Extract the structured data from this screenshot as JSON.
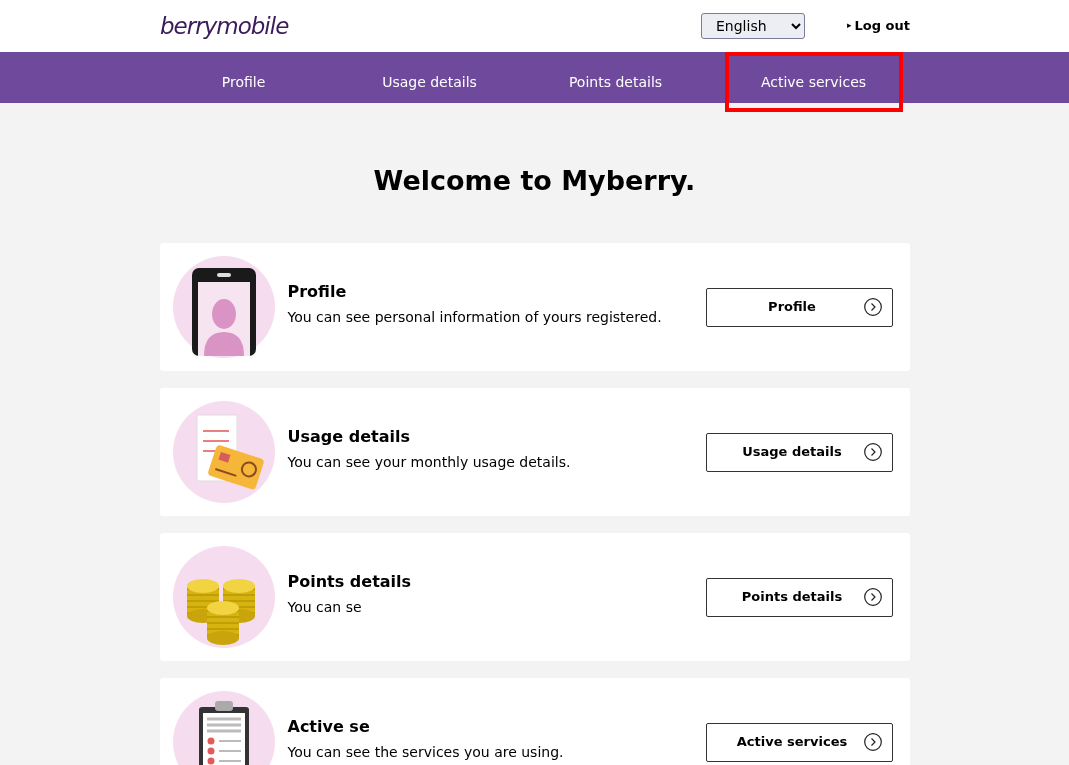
{
  "header": {
    "logo": "berrymobile",
    "language": "English",
    "logout_marker": "▸",
    "logout": "Log out"
  },
  "nav": [
    {
      "label": "Profile",
      "highlighted": false
    },
    {
      "label": "Usage details",
      "highlighted": false
    },
    {
      "label": "Points details",
      "highlighted": false
    },
    {
      "label": "Active services",
      "highlighted": true
    }
  ],
  "heading": "Welcome to Myberry.",
  "cards": [
    {
      "kind": "profile",
      "title": "Profile",
      "description": "You can see personal information of yours registered.",
      "button": "Profile"
    },
    {
      "kind": "usage",
      "title": "Usage details",
      "description": "You can see your monthly usage details.",
      "button": "Usage details"
    },
    {
      "kind": "points",
      "title": "Points details",
      "description": "You can se",
      "button": "Points details"
    },
    {
      "kind": "services",
      "title": "Active se",
      "description": "You can see the services you are using.",
      "button": "Active services"
    }
  ]
}
